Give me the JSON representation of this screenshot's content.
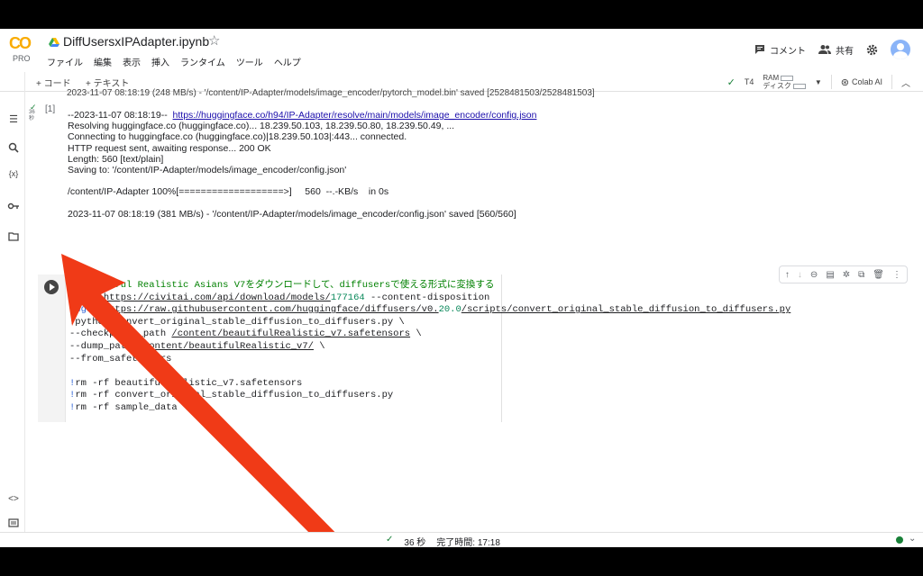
{
  "header": {
    "logo_text": "CO",
    "pro_label": "PRO",
    "notebook_title": "DiffUsersxIPAdapter.ipynb",
    "menu": [
      "ファイル",
      "編集",
      "表示",
      "挿入",
      "ランタイム",
      "ツール",
      "ヘルプ"
    ],
    "comment_label": "コメント",
    "share_label": "共有"
  },
  "toolbar": {
    "add_code": "+ コード",
    "add_text": "+ テキスト",
    "gpu_label": "T4",
    "ram_label": "RAM",
    "disk_label": "ディスク",
    "colab_ai_label": "Colab AI"
  },
  "prev_cell": {
    "top_line": "2023-11-07 08:18:19 (248 MB/s) - '/content/IP-Adapter/models/image_encoder/pytorch_model.bin' saved [2528481503/2528481503]",
    "exec_time": "36\n秒",
    "exec_count": "[1]",
    "line1_prefix": "--2023-11-07 08:18:19--  ",
    "line1_link": "https://huggingface.co/h94/IP-Adapter/resolve/main/models/image_encoder/config.json",
    "lines": [
      "Resolving huggingface.co (huggingface.co)... 18.239.50.103, 18.239.50.80, 18.239.50.49, ...",
      "Connecting to huggingface.co (huggingface.co)|18.239.50.103|:443... connected.",
      "HTTP request sent, awaiting response... 200 OK",
      "Length: 560 [text/plain]",
      "Saving to: '/content/IP-Adapter/models/image_encoder/config.json'",
      "",
      "/content/IP-Adapter 100%[===================>]     560  --.-KB/s    in 0s",
      "",
      "2023-11-07 08:18:19 (381 MB/s) - '/content/IP-Adapter/models/image_encoder/config.json' saved [560/560]"
    ]
  },
  "code_cell": {
    "comment": "# Beautiful Realistic Asians V7をダウンロードして、diffusersで使える形式に変換する",
    "l2a": "!wget ",
    "l2b": "https://civitai.com/api/download/models/",
    "l2c": "177164",
    "l2d": " --content-disposition",
    "l3a": "!wget ",
    "l3b": "https://raw.githubusercontent.com/huggingface/diffusers/v0.",
    "l3c": "20.0",
    "l3d": "/scripts/convert_original_stable_diffusion_to_diffusers.py",
    "l4": "!python convert_original_stable_diffusion_to_diffusers.py \\",
    "l5a": "--checkpoint_path ",
    "l5b": "/content/beautifulRealistic_v7.safetensors",
    "l5c": " \\",
    "l6a": "--dump_path ",
    "l6b": "/content/beautifulRealistic_v7/",
    "l6c": " \\",
    "l7": "--from_safetensors",
    "l8": "",
    "l9a": "!",
    "l9b": "rm -rf beautifulRealistic_v7.safetensors",
    "l10a": "!",
    "l10b": "rm -rf convert_original_stable_diffusion_to_diffusers.py",
    "l11a": "!",
    "l11b": "rm -rf sample_data"
  },
  "status": {
    "time_label": "36 秒",
    "done_label": "完了時間: 17:18"
  },
  "colors": {
    "arrow": "#f03a17",
    "comment": "#008000",
    "link": "#1a0dab",
    "success": "#188038"
  }
}
